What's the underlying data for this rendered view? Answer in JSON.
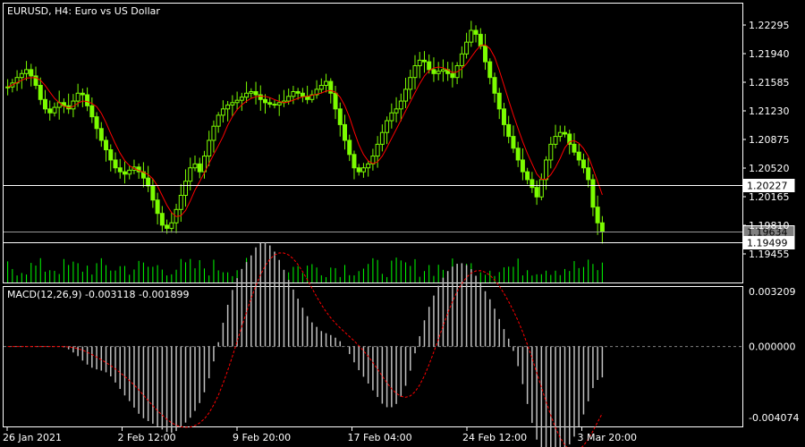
{
  "window": {
    "symbol_title": "EURUSD, H4:  Euro vs US Dollar",
    "indicator_title": "MACD(12,26,9) -0.003118 -0.001899"
  },
  "colors": {
    "background": "#000000",
    "bull_candle": "#7CFC00",
    "ma_line": "#FF0000",
    "volume": "#00FF00",
    "macd_hist": "#C0C0C0",
    "macd_signal": "#FF0000",
    "frame": "#FFFFFF",
    "bid_box": "#808080"
  },
  "price_axis": {
    "ticks": [
      "1.22295",
      "1.21940",
      "1.21585",
      "1.21230",
      "1.20875",
      "1.20520",
      "1.20165",
      "1.19810",
      "1.19455"
    ],
    "hlines": [
      {
        "label": "1.20227",
        "value": 1.20227,
        "style": "white-box"
      },
      {
        "label": "1.19634",
        "value": 1.19634,
        "style": "grey-box"
      },
      {
        "label": "1.19499",
        "value": 1.19499,
        "style": "white-box"
      }
    ]
  },
  "macd_axis": {
    "ticks": [
      "0.003209",
      "0.000000",
      "-0.004074"
    ]
  },
  "time_axis": {
    "labels": [
      "26 Jan 2021",
      "2 Feb 12:00",
      "9 Feb 20:00",
      "17 Feb 04:00",
      "24 Feb 12:00",
      "3 Mar 20:00"
    ]
  },
  "chart_data": {
    "type": "candlestick",
    "symbol": "EURUSD",
    "timeframe": "H4",
    "price_range": [
      1.194,
      1.2245
    ],
    "macd_range": [
      -0.004074,
      0.003209
    ],
    "close": [
      1.2148,
      1.2153,
      1.216,
      1.2165,
      1.217,
      1.2162,
      1.215,
      1.2132,
      1.212,
      1.2115,
      1.2122,
      1.2128,
      1.2124,
      1.212,
      1.213,
      1.214,
      1.2138,
      1.2124,
      1.211,
      1.2095,
      1.208,
      1.2068,
      1.2055,
      1.2045,
      1.204,
      1.2037,
      1.2042,
      1.2046,
      1.204,
      1.2032,
      1.2022,
      1.2004,
      1.1987,
      1.1972,
      1.1968,
      1.1975,
      1.1992,
      1.201,
      1.2028,
      1.2045,
      1.205,
      1.204,
      1.206,
      1.208,
      1.2098,
      1.2112,
      1.212,
      1.2125,
      1.2128,
      1.2131,
      1.2135,
      1.214,
      1.2142,
      1.2138,
      1.2132,
      1.2128,
      1.2126,
      1.2125,
      1.2128,
      1.213,
      1.2136,
      1.2142,
      1.214,
      1.2136,
      1.2132,
      1.2138,
      1.2145,
      1.215,
      1.2155,
      1.214,
      1.212,
      1.21,
      1.208,
      1.2062,
      1.2045,
      1.204,
      1.2045,
      1.205,
      1.206,
      1.2075,
      1.209,
      1.2105,
      1.2115,
      1.212,
      1.213,
      1.2145,
      1.216,
      1.2175,
      1.2182,
      1.218,
      1.217,
      1.2165,
      1.2168,
      1.217,
      1.2165,
      1.216,
      1.2175,
      1.219,
      1.2205,
      1.222,
      1.2215,
      1.22,
      1.218,
      1.216,
      1.214,
      1.212,
      1.21,
      1.2085,
      1.207,
      1.2055,
      1.204,
      1.203,
      1.202,
      1.2008,
      1.203,
      1.2055,
      1.2075,
      1.2085,
      1.209,
      1.2088,
      1.2075,
      1.2065,
      1.2055,
      1.2045,
      1.203,
      1.1995,
      1.1975,
      1.1964
    ],
    "ma_line": true,
    "bid": 1.19634
  }
}
